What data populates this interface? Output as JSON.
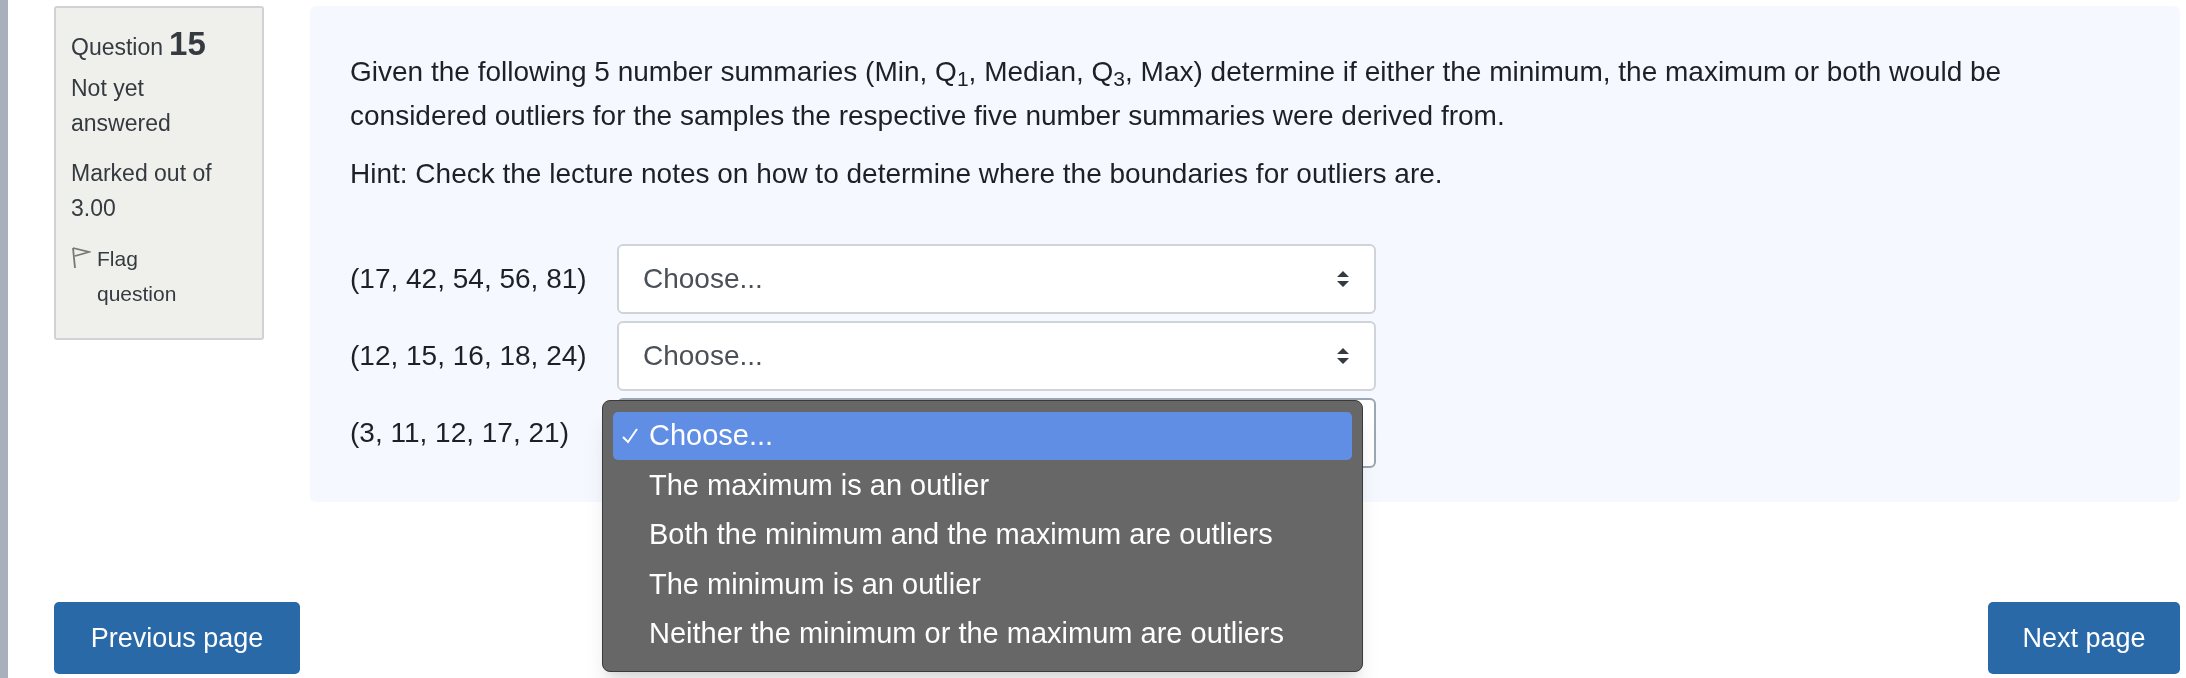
{
  "question_info": {
    "label": "Question",
    "number": "15",
    "status": "Not yet answered",
    "marks": "Marked out of 3.00",
    "flag": {
      "label": "Flag question",
      "flagged": false
    }
  },
  "question": {
    "text": "Given the following 5 number summaries (Min, Q$_{1}$, Median, Q$_{3}$, Max) determine if either the minimum, the maximum or both would be considered outliers for the samples the respective five number summaries were derived from.",
    "hint": "Hint: Check the lecture notes on how to determine where the boundaries for outliers are.",
    "rows": [
      {
        "label": "(17, 42, 54, 56, 81)",
        "value": "Choose...",
        "open": false
      },
      {
        "label": "(12, 15, 16, 18, 24)",
        "value": "Choose...",
        "open": false
      },
      {
        "label": "(3, 11, 12, 17, 21)",
        "open": true
      }
    ]
  },
  "dropdown_menu": {
    "options": [
      {
        "label": "Choose...",
        "selected": true
      },
      {
        "label": "The maximum is an outlier",
        "selected": false
      },
      {
        "label": "Both the minimum and the maximum are outliers",
        "selected": false
      },
      {
        "label": "The minimum is an outlier",
        "selected": false
      },
      {
        "label": "Neither the minimum or the maximum are outliers",
        "selected": false
      }
    ]
  },
  "navigation": {
    "previous": "Previous page",
    "next": "Next page"
  }
}
